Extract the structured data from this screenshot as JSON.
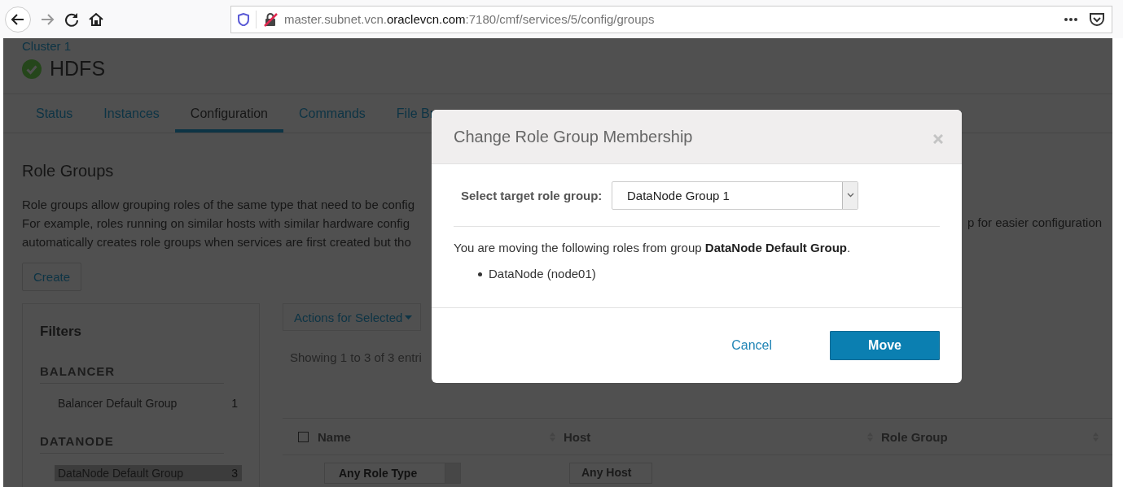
{
  "browser": {
    "url": {
      "host_prefix": "master.subnet.vcn.",
      "domain": "oraclevcn.com",
      "path": ":7180/cmf/services/5/config/groups"
    }
  },
  "page": {
    "breadcrumb": "Cluster 1",
    "service": {
      "name": "HDFS"
    },
    "tabs": [
      {
        "label": "Status",
        "selected": false
      },
      {
        "label": "Instances",
        "selected": false
      },
      {
        "label": "Configuration",
        "selected": true
      },
      {
        "label": "Commands",
        "selected": false
      },
      {
        "label": "File Br",
        "selected": false
      }
    ],
    "heading": "Role Groups",
    "description": [
      "Role groups allow grouping roles of the same type that need to be config",
      "For example, roles running on similar hosts with similar hardware config",
      "automatically creates role groups when services are first created but tho"
    ],
    "description_tail": "p for easier configuration",
    "create_button": "Create",
    "filters": {
      "title": "Filters",
      "groups": [
        {
          "title": "BALANCER",
          "items": [
            {
              "label": "Balancer Default Group",
              "count": "1",
              "selected": false
            }
          ]
        },
        {
          "title": "DATANODE",
          "items": [
            {
              "label": "DataNode Default Group",
              "count": "3",
              "selected": true
            }
          ]
        }
      ]
    },
    "actions_button": "Actions for Selected",
    "showing": "Showing 1 to 3 of 3 entri",
    "table": {
      "select_all": {
        "checked": false
      },
      "columns": [
        "Name",
        "Host",
        "Role Group"
      ],
      "column_filters": [
        "Any Role Type",
        "Any Host"
      ]
    }
  },
  "dialog": {
    "title": "Change Role Group Membership",
    "field_label": "Select target role group:",
    "select_value": "DataNode Group 1",
    "message": "You are moving the following roles from group **DataNode Default Group**.",
    "roles": [
      "DataNode (node01)"
    ],
    "cancel": "Cancel",
    "confirm": "Move"
  }
}
